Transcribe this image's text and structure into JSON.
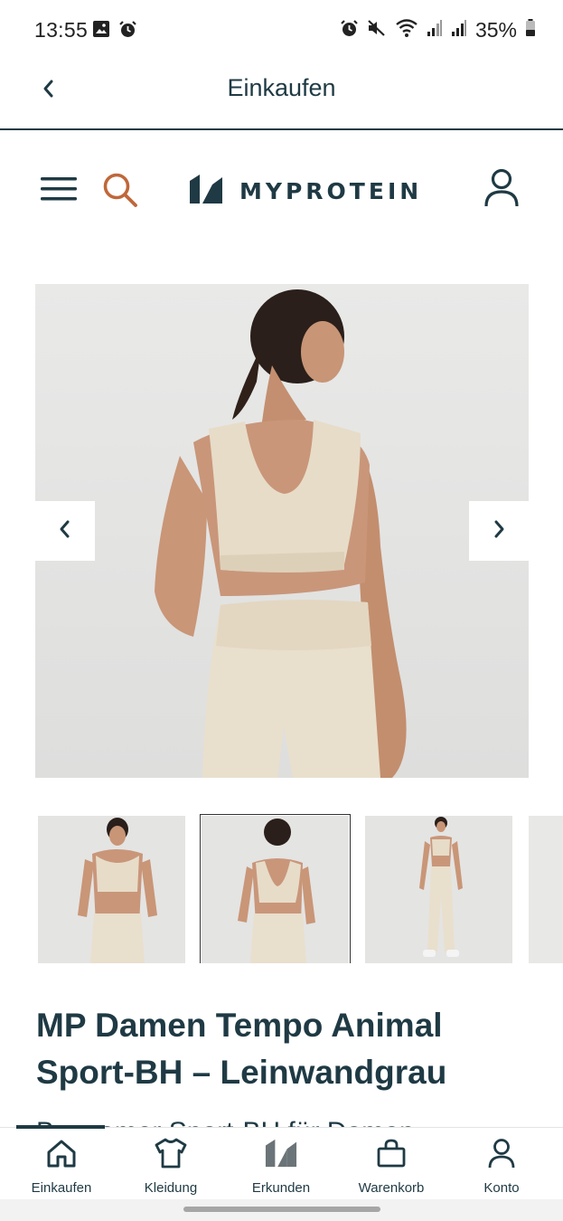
{
  "status_bar": {
    "time": "13:55",
    "left_icons": [
      "gallery-icon",
      "alarm-icon"
    ],
    "right_icons": [
      "alarm-icon",
      "mute-icon",
      "wifi-icon",
      "signal-icon",
      "signal-icon",
      "battery-icon"
    ],
    "battery": "35%"
  },
  "header": {
    "title": "Einkaufen",
    "back_icon": "chevron-left-icon"
  },
  "site_nav": {
    "menu_icon": "hamburger-menu-icon",
    "search_icon": "search-icon",
    "logo_text": "MYPROTEIN",
    "account_icon": "user-icon",
    "colors": {
      "brand": "#1f3a44",
      "search_accent": "#c0673a"
    }
  },
  "gallery": {
    "prev_icon": "chevron-left-icon",
    "next_icon": "chevron-right-icon",
    "active_thumbnail": 2
  },
  "product": {
    "title": "MP Damen Tempo Animal Sport-BH – Leinwandgrau",
    "subtitle": "Bequemer Sport-BH für Damen"
  },
  "tabs": [
    {
      "label": "Einkaufen",
      "icon": "home-icon",
      "active": true
    },
    {
      "label": "Kleidung",
      "icon": "tshirt-icon",
      "active": false
    },
    {
      "label": "Erkunden",
      "icon": "myprotein-logo-icon",
      "active": false
    },
    {
      "label": "Warenkorb",
      "icon": "shopping-bag-icon",
      "active": false
    },
    {
      "label": "Konto",
      "icon": "user-icon",
      "active": false
    }
  ]
}
